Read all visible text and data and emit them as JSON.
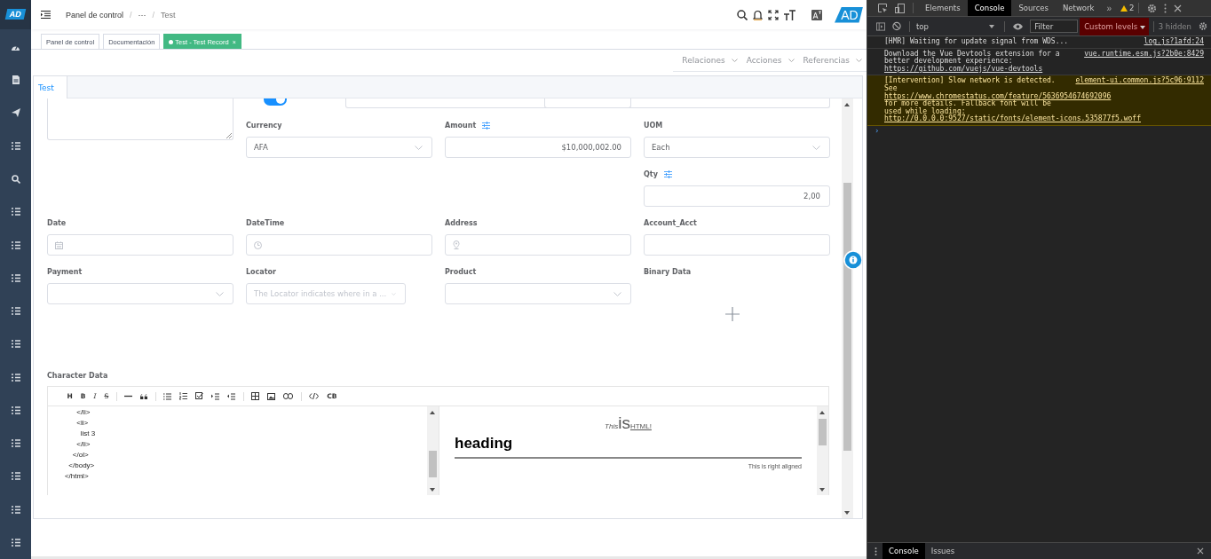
{
  "logo": "AD",
  "breadcrumb": {
    "items": [
      "Panel de control",
      "···",
      "Test"
    ],
    "separator": "/"
  },
  "header": {
    "avatar": "AD"
  },
  "tags": [
    {
      "label": "Panel de control",
      "selected": false
    },
    {
      "label": "Documentación",
      "selected": false
    },
    {
      "label": "Test - Test Record",
      "selected": true,
      "close": "×"
    }
  ],
  "actions": [
    "Relaciones",
    "Acciones",
    "Referencias"
  ],
  "tabs": [
    {
      "label": "Test",
      "selected": true
    }
  ],
  "fields": [
    {
      "kind": "textarea"
    },
    {
      "kind": "switch",
      "on": true
    },
    {
      "kind": "cut"
    },
    {
      "kind": "cut"
    },
    {
      "kind": "select",
      "label": "Currency",
      "value": "AFA"
    },
    {
      "kind": "number",
      "label": "Amount",
      "value": "$10,000,002.00"
    },
    {
      "kind": "select",
      "label": "UOM",
      "value": "Each"
    },
    {
      "kind": "number",
      "label": "Qty",
      "value": "2,00"
    },
    {
      "kind": "date",
      "label": "Date"
    },
    {
      "kind": "datetime",
      "label": "DateTime"
    },
    {
      "kind": "location",
      "label": "Address"
    },
    {
      "kind": "text",
      "label": "Account_Acct"
    },
    {
      "kind": "select",
      "label": "Payment"
    },
    {
      "kind": "select",
      "label": "Locator",
      "placeholder": "The Locator indicates where in a ..."
    },
    {
      "kind": "select",
      "label": "Product"
    },
    {
      "kind": "upload",
      "label": "Binary Data"
    }
  ],
  "editor": {
    "label": "Character Data",
    "toolbar": [
      {
        "kind": "text",
        "label": "H"
      },
      {
        "kind": "bold",
        "label": "B"
      },
      {
        "kind": "italic",
        "label": "I"
      },
      {
        "kind": "strike",
        "label": "S"
      },
      {
        "kind": "separator"
      },
      {
        "kind": "rule"
      },
      {
        "kind": "quote"
      },
      {
        "kind": "separator"
      },
      {
        "kind": "bullets"
      },
      {
        "kind": "numbers"
      },
      {
        "kind": "tasks"
      },
      {
        "kind": "indent"
      },
      {
        "kind": "outdent"
      },
      {
        "kind": "separator"
      },
      {
        "kind": "table"
      },
      {
        "kind": "image"
      },
      {
        "kind": "link"
      },
      {
        "kind": "separator"
      },
      {
        "kind": "code"
      },
      {
        "kind": "text",
        "label": "CB"
      }
    ],
    "code_lines": [
      "          </li>",
      "          <li>",
      "            list 3",
      "          </li>",
      "        </ol>",
      "      </body>",
      "    </html>"
    ],
    "preview": {
      "line": [
        {
          "kind": "italic",
          "text": "This"
        },
        {
          "kind": "large",
          "text": "is"
        },
        {
          "kind": "link",
          "text": "HTML!"
        }
      ],
      "heading": "heading",
      "right_text": "This is right aligned"
    }
  },
  "devtools": {
    "tabs": [
      {
        "label": "Elements",
        "selected": false
      },
      {
        "label": "Console",
        "selected": true
      },
      {
        "label": "Sources",
        "selected": false
      },
      {
        "label": "Network",
        "selected": false
      }
    ],
    "more": "»",
    "warnings": "2",
    "context": "top",
    "filter_placeholder": "Filter",
    "levels": "Custom levels",
    "hidden": "3 hidden",
    "messages": [
      {
        "kind": "info",
        "source": "log.js?1afd:24",
        "parts": [
          {
            "kind": "text",
            "text": "[HMR] Waiting for update signal from WDS..."
          }
        ]
      },
      {
        "kind": "info",
        "source": "vue.runtime.esm.js?2b0e:8429",
        "parts": [
          {
            "kind": "text",
            "text": "Download the Vue Devtools extension for a better development experience: "
          },
          {
            "kind": "link",
            "text": "https://github.com/vuejs/vue-devtools"
          }
        ]
      },
      {
        "kind": "warning",
        "source": "element-ui.common.js?5c96:9112",
        "parts": [
          {
            "kind": "text",
            "text": "[Intervention] Slow network is detected. See "
          },
          {
            "kind": "link",
            "text": "https://www.chromestatus.com/feature/5636954674692096"
          },
          {
            "kind": "text",
            "text": " for more details. Fallback font will be used while loading: "
          },
          {
            "kind": "link",
            "text": "http://0.0.0.0:9527/static/fonts/element-icons.535877f5.woff"
          }
        ]
      }
    ],
    "prompt": "›",
    "drawer_tabs": [
      {
        "label": "Console",
        "selected": true
      },
      {
        "label": "Issues",
        "selected": false
      }
    ]
  }
}
